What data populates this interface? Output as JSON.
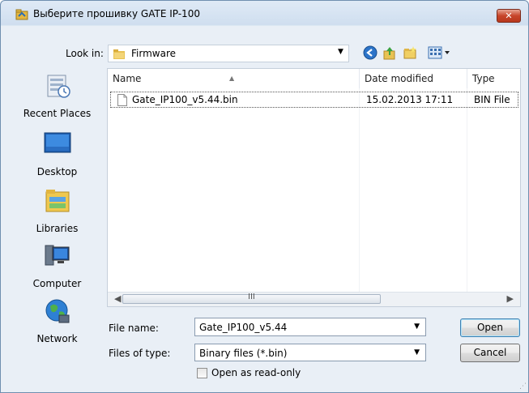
{
  "window": {
    "title": "Выберите прошивку GATE IP-100",
    "close_glyph": "✕"
  },
  "lookin": {
    "label": "Look in:",
    "value": "Firmware",
    "arrow": "▼"
  },
  "toolbar": {
    "icons": [
      "back-icon",
      "up-folder-icon",
      "new-folder-icon",
      "views-menu-icon"
    ]
  },
  "places": [
    {
      "label": "Recent Places",
      "icon": "recent-places-icon"
    },
    {
      "label": "Desktop",
      "icon": "desktop-icon"
    },
    {
      "label": "Libraries",
      "icon": "libraries-icon"
    },
    {
      "label": "Computer",
      "icon": "computer-icon"
    },
    {
      "label": "Network",
      "icon": "network-icon"
    }
  ],
  "list": {
    "columns": [
      "Name",
      "Date modified",
      "Type"
    ],
    "rows": [
      {
        "name": "Gate_IP100_v5.44.bin",
        "date": "15.02.2013 17:11",
        "type": "BIN File"
      }
    ],
    "scroll_left": "◀",
    "scroll_right": "▶",
    "scroll_grip": "III"
  },
  "filename": {
    "label": "File name:",
    "value": "Gate_IP100_v5.44",
    "arrow": "▼"
  },
  "filetype": {
    "label": "Files of type:",
    "value": "Binary files (*.bin)",
    "arrow": "▼"
  },
  "readonly": {
    "label": "Open as read-only"
  },
  "buttons": {
    "open": "Open",
    "cancel": "Cancel"
  },
  "colors": {
    "title_gradient": "#dfeaf6",
    "close_red": "#c7452a",
    "default_button_border": "#3c7fb1"
  }
}
